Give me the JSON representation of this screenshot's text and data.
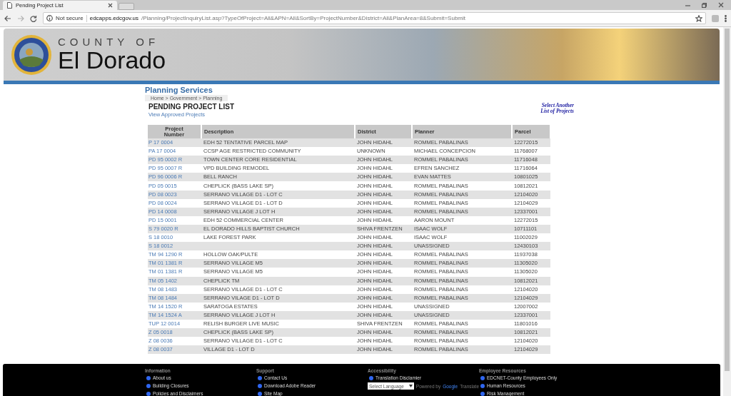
{
  "browser": {
    "tab_title": "Pending Project List",
    "security": "Not secure",
    "url_domain": "edcapps.edcgov.us",
    "url_path": "/Planning/ProjectInquiryList.asp?TypeOfProject=All&APN=All&SortBy=ProjectNumber&District=All&PlanArea=8&Submit=Submit"
  },
  "banner": {
    "overline": "COUNTY OF",
    "title": "El Dorado"
  },
  "section_title": "Planning Services",
  "breadcrumb": "Home > Government > Planning",
  "page_title": "PENDING PROJECT LIST",
  "approved_link": "View Approved Projects",
  "select_link": [
    "Select Another",
    "List of Projects"
  ],
  "table": {
    "columns": [
      "Project Number",
      "Description",
      "District",
      "Planner",
      "Parcel"
    ],
    "rows": [
      [
        "P 17 0004",
        "EDH 52 TENTATIVE PARCEL MAP",
        "JOHN HIDAHL",
        "ROMMEL PABALINAS",
        "12272015"
      ],
      [
        "PA 17 0004",
        "CCSP AGE RESTRICTED COMMUNITY",
        "UNKNOWN",
        "MICHAEL CONCEPCION",
        "11768007"
      ],
      [
        "PD 95 0002 R",
        "TOWN CENTER CORE RESIDENTIAL",
        "JOHN HIDAHL",
        "ROMMEL PABALINAS",
        "11716048"
      ],
      [
        "PD 95 0007 R",
        "VPD BUILDING REMODEL",
        "JOHN HIDAHL",
        "EFREN SANCHEZ",
        "11716064"
      ],
      [
        "PD 96 0006 R",
        "BELL RANCH",
        "JOHN HIDAHL",
        "EVAN MATTES",
        "10801025"
      ],
      [
        "PD 05 0015",
        "CHEPLICK (BASS LAKE SP)",
        "JOHN HIDAHL",
        "ROMMEL PABALINAS",
        "10812021"
      ],
      [
        "PD 08 0023",
        "SERRANO VILLAGE D1 - LOT C",
        "JOHN HIDAHL",
        "ROMMEL PABALINAS",
        "12104020"
      ],
      [
        "PD 08 0024",
        "SERRANO VILLAGE D1 - LOT D",
        "JOHN HIDAHL",
        "ROMMEL PABALINAS",
        "12104029"
      ],
      [
        "PD 14 0008",
        "SERRANO VILLAGE J LOT H",
        "JOHN HIDAHL",
        "ROMMEL PABALINAS",
        "12337001"
      ],
      [
        "PD 15 0001",
        "EDH 52 COMMERCIAL CENTER",
        "JOHN HIDAHL",
        "AARON MOUNT",
        "12272015"
      ],
      [
        "S 79 0020 R",
        "EL DORADO HILLS BAPTIST CHURCH",
        "SHIVA FRENTZEN",
        "ISAAC WOLF",
        "10711101"
      ],
      [
        "S 18 0010",
        "LAKE FOREST PARK",
        "JOHN HIDAHL",
        "ISAAC WOLF",
        "11002029"
      ],
      [
        "S 18 0012",
        "",
        "JOHN HIDAHL",
        "UNASSIGNED",
        "12430103"
      ],
      [
        "TM 94 1290 R",
        "HOLLOW OAK/PULTE",
        "JOHN HIDAHL",
        "ROMMEL PABALINAS",
        "11937038"
      ],
      [
        "TM 01 1381 R",
        "SERRANO VILLAGE M5",
        "JOHN HIDAHL",
        "ROMMEL PABALINAS",
        "11305020"
      ],
      [
        "TM 01 1381 R",
        "SERRANO VILLAGE M5",
        "JOHN HIDAHL",
        "ROMMEL PABALINAS",
        "11305020"
      ],
      [
        "TM 05 1402",
        "CHEPLICK TM",
        "JOHN HIDAHL",
        "ROMMEL PABALINAS",
        "10812021"
      ],
      [
        "TM 08 1483",
        "SERRANO VILLAGE D1 - LOT C",
        "JOHN HIDAHL",
        "ROMMEL PABALINAS",
        "12104020"
      ],
      [
        "TM 08 1484",
        "SERRANO VILAGE D1 - LOT D",
        "JOHN HIDAHL",
        "ROMMEL PABALINAS",
        "12104029"
      ],
      [
        "TM 14 1520 R",
        "SARATOGA ESTATES",
        "JOHN HIDAHL",
        "UNASSIGNED",
        "12007002"
      ],
      [
        "TM 14 1524 A",
        "SERRANO VILLAGE J LOT H",
        "JOHN HIDAHL",
        "UNASSIGNED",
        "12337001"
      ],
      [
        "TUP 12 0014",
        "RELISH BURGER LIVE MUSIC",
        "SHIVA FRENTZEN",
        "ROMMEL PABALINAS",
        "11801016"
      ],
      [
        "Z 05 0018",
        "CHEPLICK (BASS LAKE SP)",
        "JOHN HIDAHL",
        "ROMMEL PABALINAS",
        "10812021"
      ],
      [
        "Z 08 0036",
        "SERRANO VILLAGE D1 - LOT C",
        "JOHN HIDAHL",
        "ROMMEL PABALINAS",
        "12104020"
      ],
      [
        "Z 08 0037",
        "VILLAGE D1 - LOT D",
        "JOHN HIDAHL",
        "ROMMEL PABALINAS",
        "12104029"
      ]
    ]
  },
  "footer": [
    {
      "heading": "Information",
      "links": [
        "About us",
        "Building Closures",
        "Policies and Disclaimers"
      ]
    },
    {
      "heading": "Support",
      "links": [
        "Contact Us",
        "Download Adobe Reader",
        "Site Map"
      ]
    },
    {
      "heading": "Accessibility",
      "links": [
        "Translation Disclamier"
      ],
      "language_select": "Select Language",
      "powered_by": "Powered by",
      "translate_brand": "Google",
      "translate_word": "Translate"
    },
    {
      "heading": "Employee Resources",
      "links": [
        "EDCNET-County Employees Only",
        "Human Resources",
        "Risk Management"
      ]
    }
  ]
}
